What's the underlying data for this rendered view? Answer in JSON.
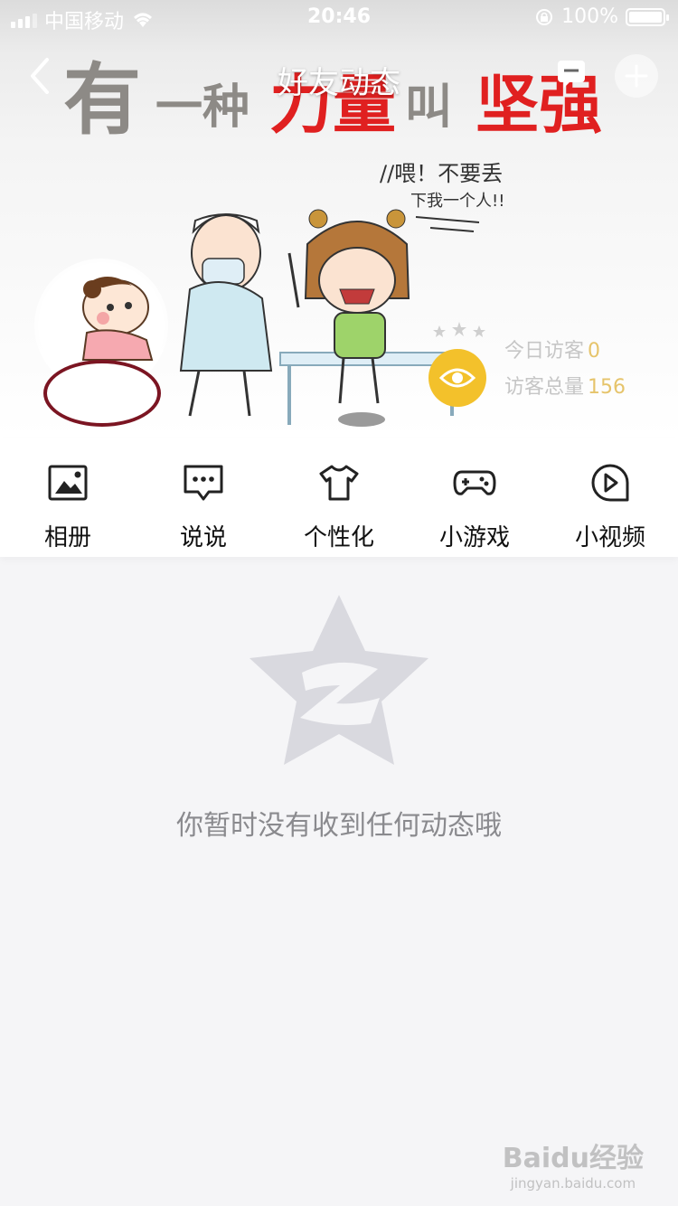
{
  "status_bar": {
    "carrier": "中国移动",
    "time": "20:46",
    "battery": "100%"
  },
  "header": {
    "title": "好友动态",
    "banner_slogan": "有一种力量叫坚强",
    "cartoon_text": "喂！不要丢下我一个人!!"
  },
  "visitors": {
    "today_label": "今日访客",
    "today_count": "0",
    "total_label": "访客总量",
    "total_count": "156"
  },
  "menu": {
    "items": [
      {
        "label": "相册",
        "icon": "photo-album-icon"
      },
      {
        "label": "说说",
        "icon": "chat-bubble-icon"
      },
      {
        "label": "个性化",
        "icon": "tshirt-icon"
      },
      {
        "label": "小游戏",
        "icon": "gamepad-icon"
      },
      {
        "label": "小视频",
        "icon": "play-video-icon"
      }
    ]
  },
  "empty_state": {
    "message": "你暂时没有收到任何动态哦"
  },
  "watermark": {
    "brand": "Baidu经验",
    "url": "jingyan.baidu.com"
  },
  "colors": {
    "accent_yellow": "#f3c12b",
    "slogan_red": "#e02020",
    "slogan_gray": "#8d8a86",
    "empty_gray": "#8a8a8e",
    "avatar_mark": "#7b1522"
  }
}
